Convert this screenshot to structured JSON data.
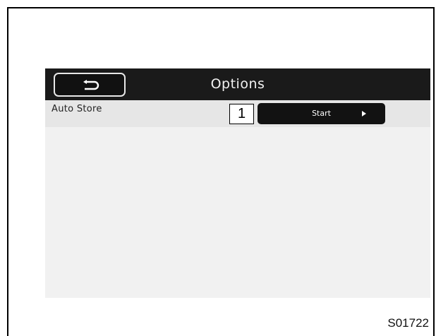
{
  "header": {
    "title": "Options",
    "back_icon": "return-arrow-icon"
  },
  "rows": [
    {
      "label": "Auto Store",
      "callout_number": "1",
      "button_label": "Start",
      "button_icon": "play-arrow-icon"
    }
  ],
  "figure_code": "S01722",
  "colors": {
    "header_bg": "#1a1a1a",
    "screen_bg": "#f1f1f1",
    "row_bg": "#e6e6e6",
    "button_bg": "#121212"
  }
}
